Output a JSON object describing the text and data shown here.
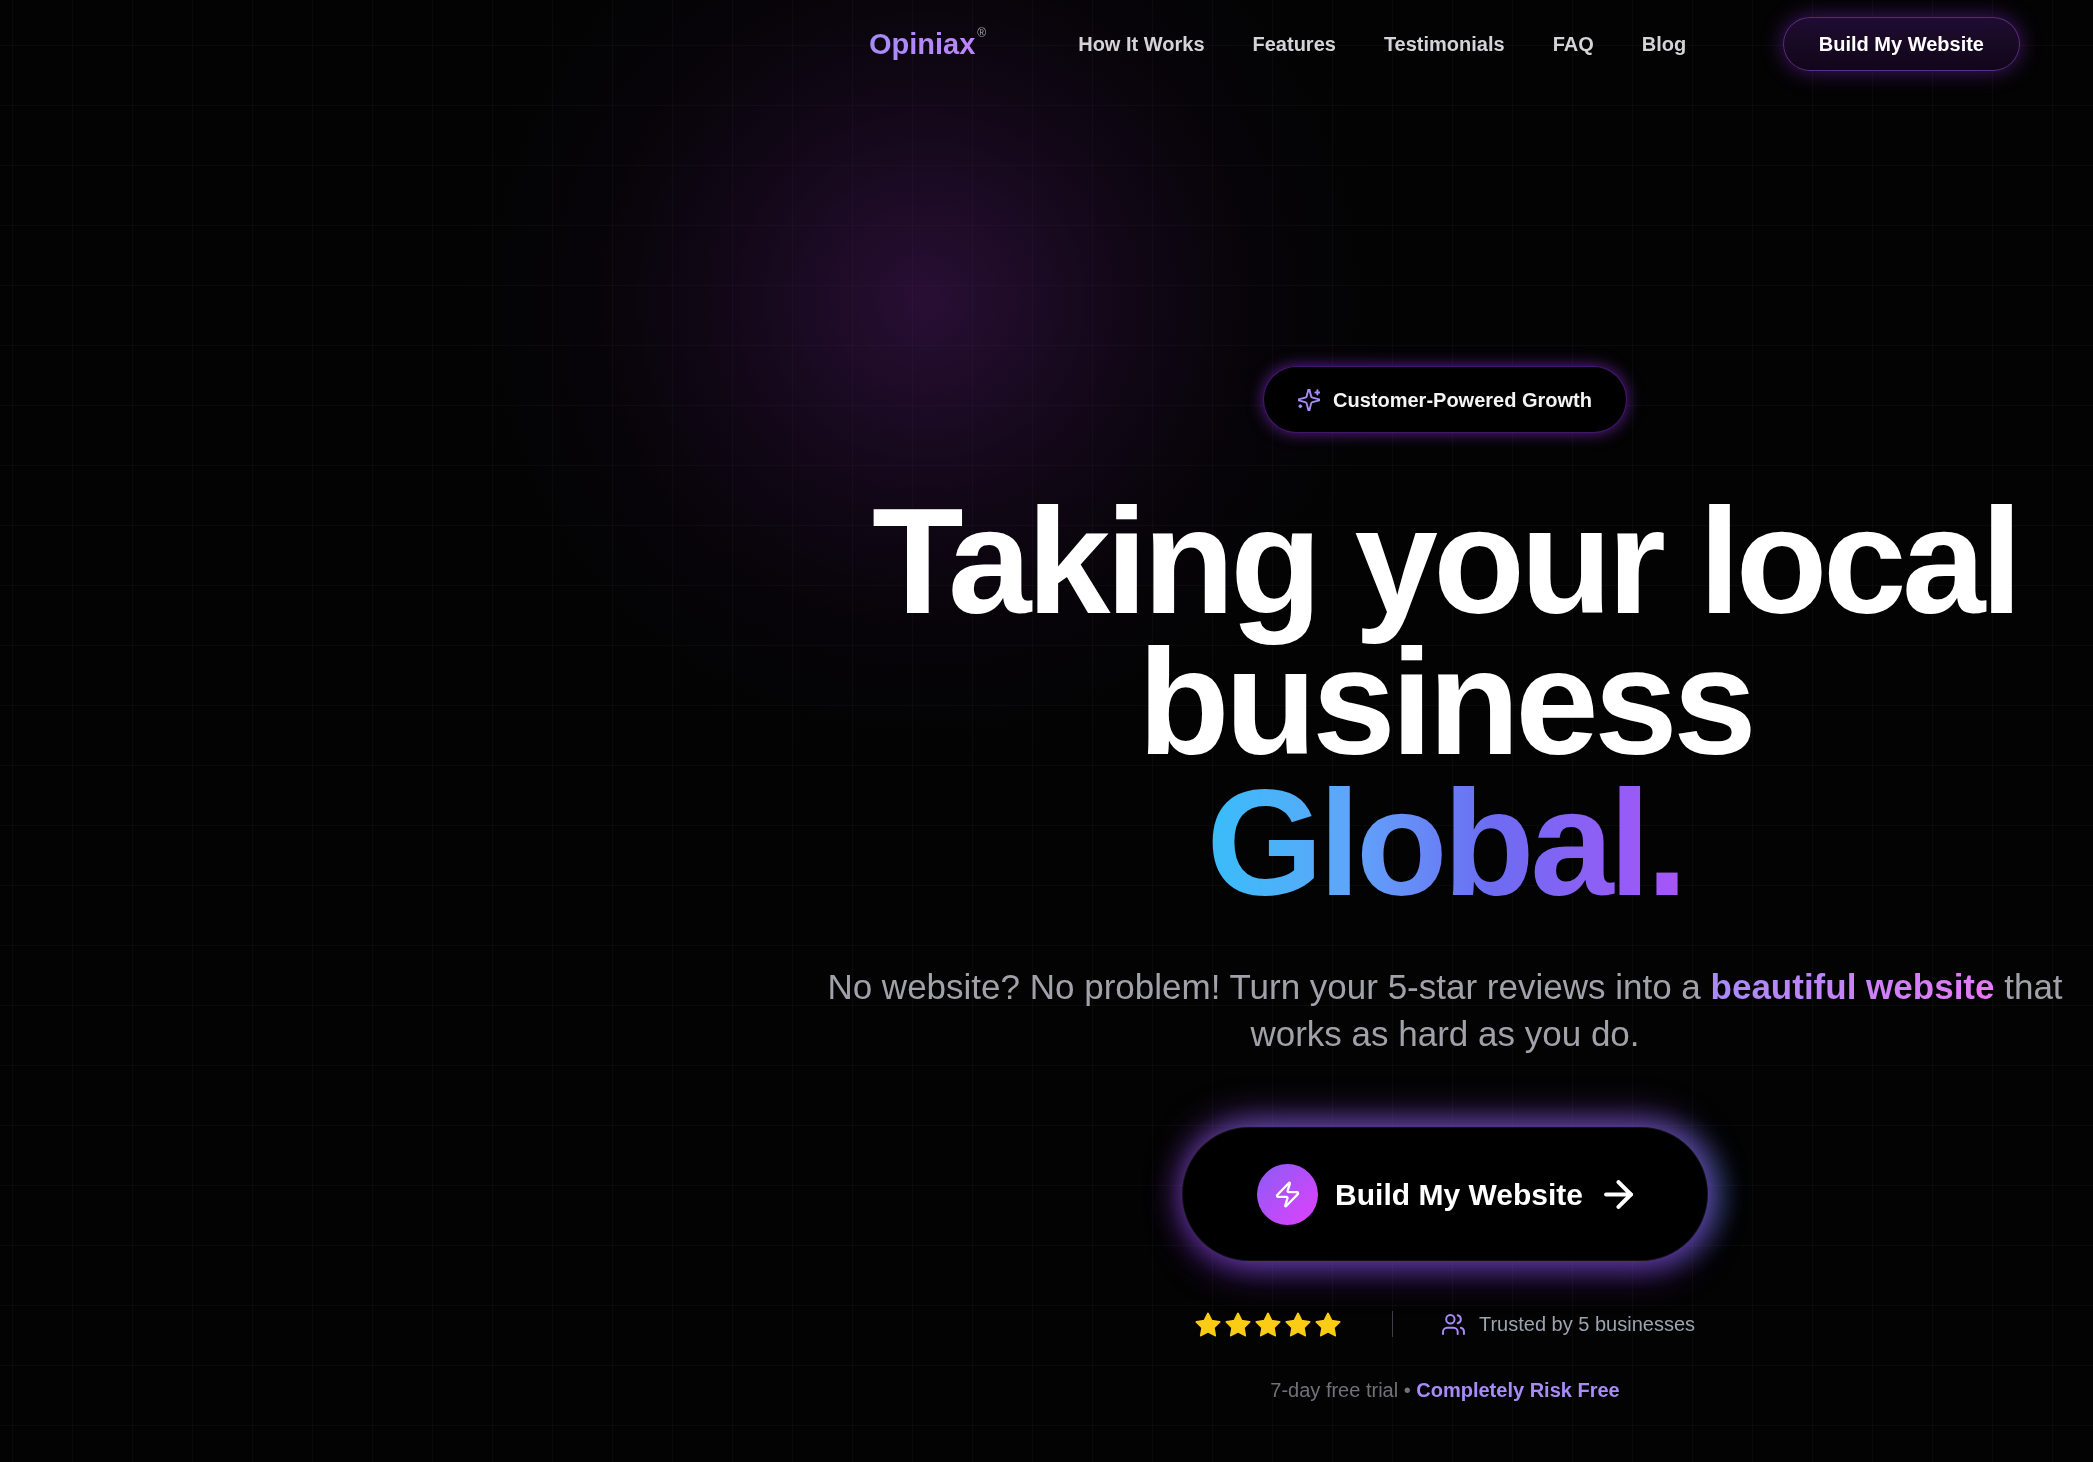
{
  "nav": {
    "logo": "Opiniax$^{®}$",
    "links": [
      {
        "label": "How It Works"
      },
      {
        "label": "Features"
      },
      {
        "label": "Testimonials"
      },
      {
        "label": "FAQ"
      },
      {
        "label": "Blog"
      }
    ],
    "cta": "Build My Website"
  },
  "hero": {
    "badge": "Customer-Powered Growth",
    "headline": "Taking your local business **Global.**",
    "subtitle": "No website? No problem! Turn your 5-star reviews into a **beautiful website** that works as hard as you do.",
    "cta": "Build My Website",
    "rating": {
      "stars": 5
    },
    "trusted": "Trusted by 5 businesses",
    "note": "7-day free trial • **Completely Risk Free**"
  }
}
